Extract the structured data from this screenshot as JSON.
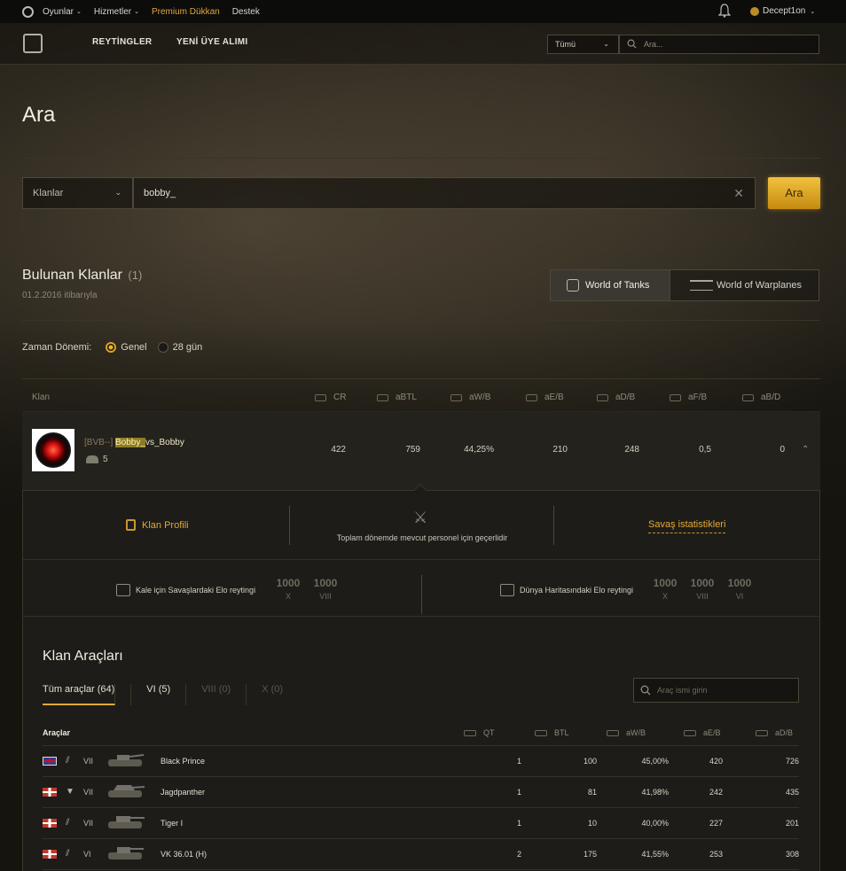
{
  "topbar": {
    "menus": [
      "Oyunlar",
      "Hizmetler",
      "Premium Dükkan",
      "Destek"
    ],
    "user": "Decept1on"
  },
  "nav": {
    "links": [
      "REYTİNGLER",
      "YENİ ÜYE ALIMI"
    ],
    "select_value": "Tümü",
    "search_placeholder": "Ara..."
  },
  "page_title": "Ara",
  "search": {
    "filter_value": "Klanlar",
    "query": "bobby_",
    "button": "Ara"
  },
  "results": {
    "title": "Bulunan Klanlar",
    "count": "(1)",
    "date": "01.2.2016 itibarıyla"
  },
  "game_tabs": [
    "World of Tanks",
    "World of Warplanes"
  ],
  "period": {
    "label": "Zaman Dönemi:",
    "options": [
      "Genel",
      "28 gün"
    ],
    "selected": "Genel"
  },
  "clan_table": {
    "headers": [
      "Klan",
      "CR",
      "aBTL",
      "aW/B",
      "aE/B",
      "aD/B",
      "aF/B",
      "aB/D"
    ],
    "row": {
      "tag": "[BVB--]",
      "name_highlight": "Bobby_",
      "name_rest": "vs_Bobby",
      "members": "5",
      "values": [
        "422",
        "759",
        "44,25%",
        "210",
        "248",
        "0,5",
        "0"
      ]
    }
  },
  "detail": {
    "profile_link": "Klan Profili",
    "note": "Toplam dönemde mevcut personel için geçerlidir",
    "stats_link": "Savaş istatistikleri",
    "elo_stronghold": {
      "label": "Kale için Savaşlardaki Elo reytingi",
      "values": [
        {
          "num": "1000",
          "tier": "X"
        },
        {
          "num": "1000",
          "tier": "VIII"
        }
      ]
    },
    "elo_globalmap": {
      "label": "Dünya Haritasındaki Elo reytingi",
      "values": [
        {
          "num": "1000",
          "tier": "X"
        },
        {
          "num": "1000",
          "tier": "VIII"
        },
        {
          "num": "1000",
          "tier": "VI"
        }
      ]
    }
  },
  "vehicles": {
    "title": "Klan Araçları",
    "tabs": [
      "Tüm araçlar (64)",
      "VI (5)",
      "VIII (0)",
      "X (0)"
    ],
    "search_placeholder": "Araç ismi girin",
    "headers": [
      "Araçlar",
      "QT",
      "BTL",
      "aW/B",
      "aE/B",
      "aD/B"
    ],
    "rows": [
      {
        "nation": "uk",
        "class_icon": "medium-tank-icon",
        "tier": "VII",
        "name": "Black Prince",
        "qt": "1",
        "btl": "100",
        "awb": "45,00%",
        "aeb": "420",
        "adb": "726"
      },
      {
        "nation": "de",
        "class_icon": "td-icon",
        "tier": "VII",
        "name": "Jagdpanther",
        "qt": "1",
        "btl": "81",
        "awb": "41,98%",
        "aeb": "242",
        "adb": "435"
      },
      {
        "nation": "de",
        "class_icon": "heavy-tank-icon",
        "tier": "VII",
        "name": "Tiger I",
        "qt": "1",
        "btl": "10",
        "awb": "40,00%",
        "aeb": "227",
        "adb": "201"
      },
      {
        "nation": "de",
        "class_icon": "heavy-tank-icon",
        "tier": "VI",
        "name": "VK 36.01 (H)",
        "qt": "2",
        "btl": "175",
        "awb": "41,55%",
        "aeb": "253",
        "adb": "308"
      }
    ]
  },
  "colors": {
    "accent": "#e2a83a",
    "button": "#f1c23e",
    "background": "#15140f"
  }
}
